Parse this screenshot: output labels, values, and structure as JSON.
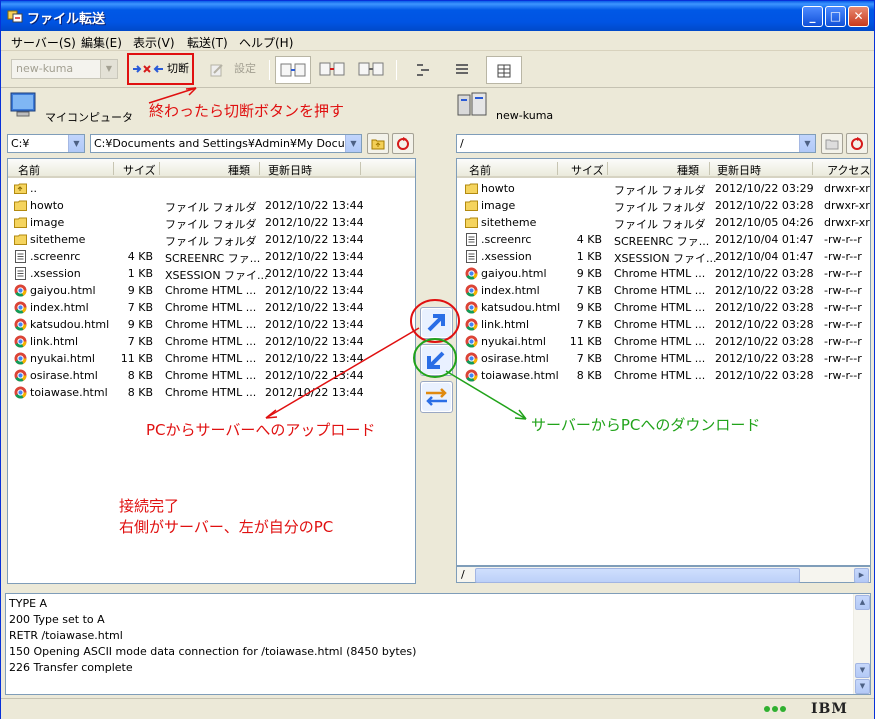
{
  "window": {
    "title": "ファイル転送",
    "min_label": "_",
    "max_label": "□",
    "close_label": "✕"
  },
  "menu": [
    "サーバー(S)",
    "編集(E)",
    "表示(V)",
    "転送(T)",
    "ヘルプ(H)"
  ],
  "toolbar": {
    "connection_combo": "new-kuma",
    "disconnect_label": "切断",
    "settings_label": "設定"
  },
  "left": {
    "title": "マイコンピュータ",
    "drive": "C:¥",
    "path": "C:¥Documents and Settings¥Admin¥My Documen",
    "columns": [
      "名前",
      "サイズ",
      "種類",
      "更新日時"
    ],
    "rows": [
      {
        "name": "..",
        "size": "",
        "type": "",
        "date": "",
        "icon": "folder-up"
      },
      {
        "name": "howto",
        "size": "",
        "type": "ファイル フォルダ",
        "date": "2012/10/22 13:44",
        "icon": "folder"
      },
      {
        "name": "image",
        "size": "",
        "type": "ファイル フォルダ",
        "date": "2012/10/22 13:44",
        "icon": "folder"
      },
      {
        "name": "sitetheme",
        "size": "",
        "type": "ファイル フォルダ",
        "date": "2012/10/22 13:44",
        "icon": "folder"
      },
      {
        "name": ".screenrc",
        "size": "4 KB",
        "type": "SCREENRC ファ...",
        "date": "2012/10/22 13:44",
        "icon": "text-file"
      },
      {
        "name": ".xsession",
        "size": "1 KB",
        "type": "XSESSION ファイ...",
        "date": "2012/10/22 13:44",
        "icon": "text-file"
      },
      {
        "name": "gaiyou.html",
        "size": "9 KB",
        "type": "Chrome HTML ...",
        "date": "2012/10/22 13:44",
        "icon": "chrome"
      },
      {
        "name": "index.html",
        "size": "7 KB",
        "type": "Chrome HTML ...",
        "date": "2012/10/22 13:44",
        "icon": "chrome"
      },
      {
        "name": "katsudou.html",
        "size": "9 KB",
        "type": "Chrome HTML ...",
        "date": "2012/10/22 13:44",
        "icon": "chrome"
      },
      {
        "name": "link.html",
        "size": "7 KB",
        "type": "Chrome HTML ...",
        "date": "2012/10/22 13:44",
        "icon": "chrome"
      },
      {
        "name": "nyukai.html",
        "size": "11 KB",
        "type": "Chrome HTML ...",
        "date": "2012/10/22 13:44",
        "icon": "chrome"
      },
      {
        "name": "osirase.html",
        "size": "8 KB",
        "type": "Chrome HTML ...",
        "date": "2012/10/22 13:44",
        "icon": "chrome"
      },
      {
        "name": "toiawase.html",
        "size": "8 KB",
        "type": "Chrome HTML ...",
        "date": "2012/10/22 13:44",
        "icon": "chrome"
      }
    ]
  },
  "right": {
    "title": "new-kuma",
    "path": "/",
    "hpath": "/",
    "columns": [
      "名前",
      "サイズ",
      "種類",
      "更新日時",
      "アクセス権"
    ],
    "rows": [
      {
        "name": "howto",
        "size": "",
        "type": "ファイル フォルダ",
        "date": "2012/10/22 03:29",
        "perm": "drwxr-xr",
        "icon": "folder"
      },
      {
        "name": "image",
        "size": "",
        "type": "ファイル フォルダ",
        "date": "2012/10/22 03:28",
        "perm": "drwxr-xr",
        "icon": "folder"
      },
      {
        "name": "sitetheme",
        "size": "",
        "type": "ファイル フォルダ",
        "date": "2012/10/05 04:26",
        "perm": "drwxr-xr",
        "icon": "folder"
      },
      {
        "name": ".screenrc",
        "size": "4 KB",
        "type": "SCREENRC ファ...",
        "date": "2012/10/04 01:47",
        "perm": "-rw-r--r",
        "icon": "text-file"
      },
      {
        "name": ".xsession",
        "size": "1 KB",
        "type": "XSESSION ファイ...",
        "date": "2012/10/04 01:47",
        "perm": "-rw-r--r",
        "icon": "text-file"
      },
      {
        "name": "gaiyou.html",
        "size": "9 KB",
        "type": "Chrome HTML ...",
        "date": "2012/10/22 03:28",
        "perm": "-rw-r--r",
        "icon": "chrome"
      },
      {
        "name": "index.html",
        "size": "7 KB",
        "type": "Chrome HTML ...",
        "date": "2012/10/22 03:28",
        "perm": "-rw-r--r",
        "icon": "chrome"
      },
      {
        "name": "katsudou.html",
        "size": "9 KB",
        "type": "Chrome HTML ...",
        "date": "2012/10/22 03:28",
        "perm": "-rw-r--r",
        "icon": "chrome"
      },
      {
        "name": "link.html",
        "size": "7 KB",
        "type": "Chrome HTML ...",
        "date": "2012/10/22 03:28",
        "perm": "-rw-r--r",
        "icon": "chrome"
      },
      {
        "name": "nyukai.html",
        "size": "11 KB",
        "type": "Chrome HTML ...",
        "date": "2012/10/22 03:28",
        "perm": "-rw-r--r",
        "icon": "chrome"
      },
      {
        "name": "osirase.html",
        "size": "7 KB",
        "type": "Chrome HTML ...",
        "date": "2012/10/22 03:28",
        "perm": "-rw-r--r",
        "icon": "chrome"
      },
      {
        "name": "toiawase.html",
        "size": "8 KB",
        "type": "Chrome HTML ...",
        "date": "2012/10/22 03:28",
        "perm": "-rw-r--r",
        "icon": "chrome"
      }
    ]
  },
  "log": [
    "TYPE A",
    "200  Type set to A",
    "RETR /toiawase.html",
    "150  Opening ASCII mode data connection for /toiawase.html (8450 bytes)",
    "226  Transfer complete"
  ],
  "status": {
    "ibm": "IBM"
  },
  "annotations": {
    "disconnect": "終わったら切断ボタンを押す",
    "upload": "PCからサーバーへのアップロード",
    "download": "サーバーからPCへのダウンロード",
    "connected_1": "接続完了",
    "connected_2": "右側がサーバー、左が自分のPC"
  },
  "colors": {
    "annotation_red": "#e01010",
    "annotation_green": "#21a31a",
    "title_blue": "#0054e3"
  }
}
